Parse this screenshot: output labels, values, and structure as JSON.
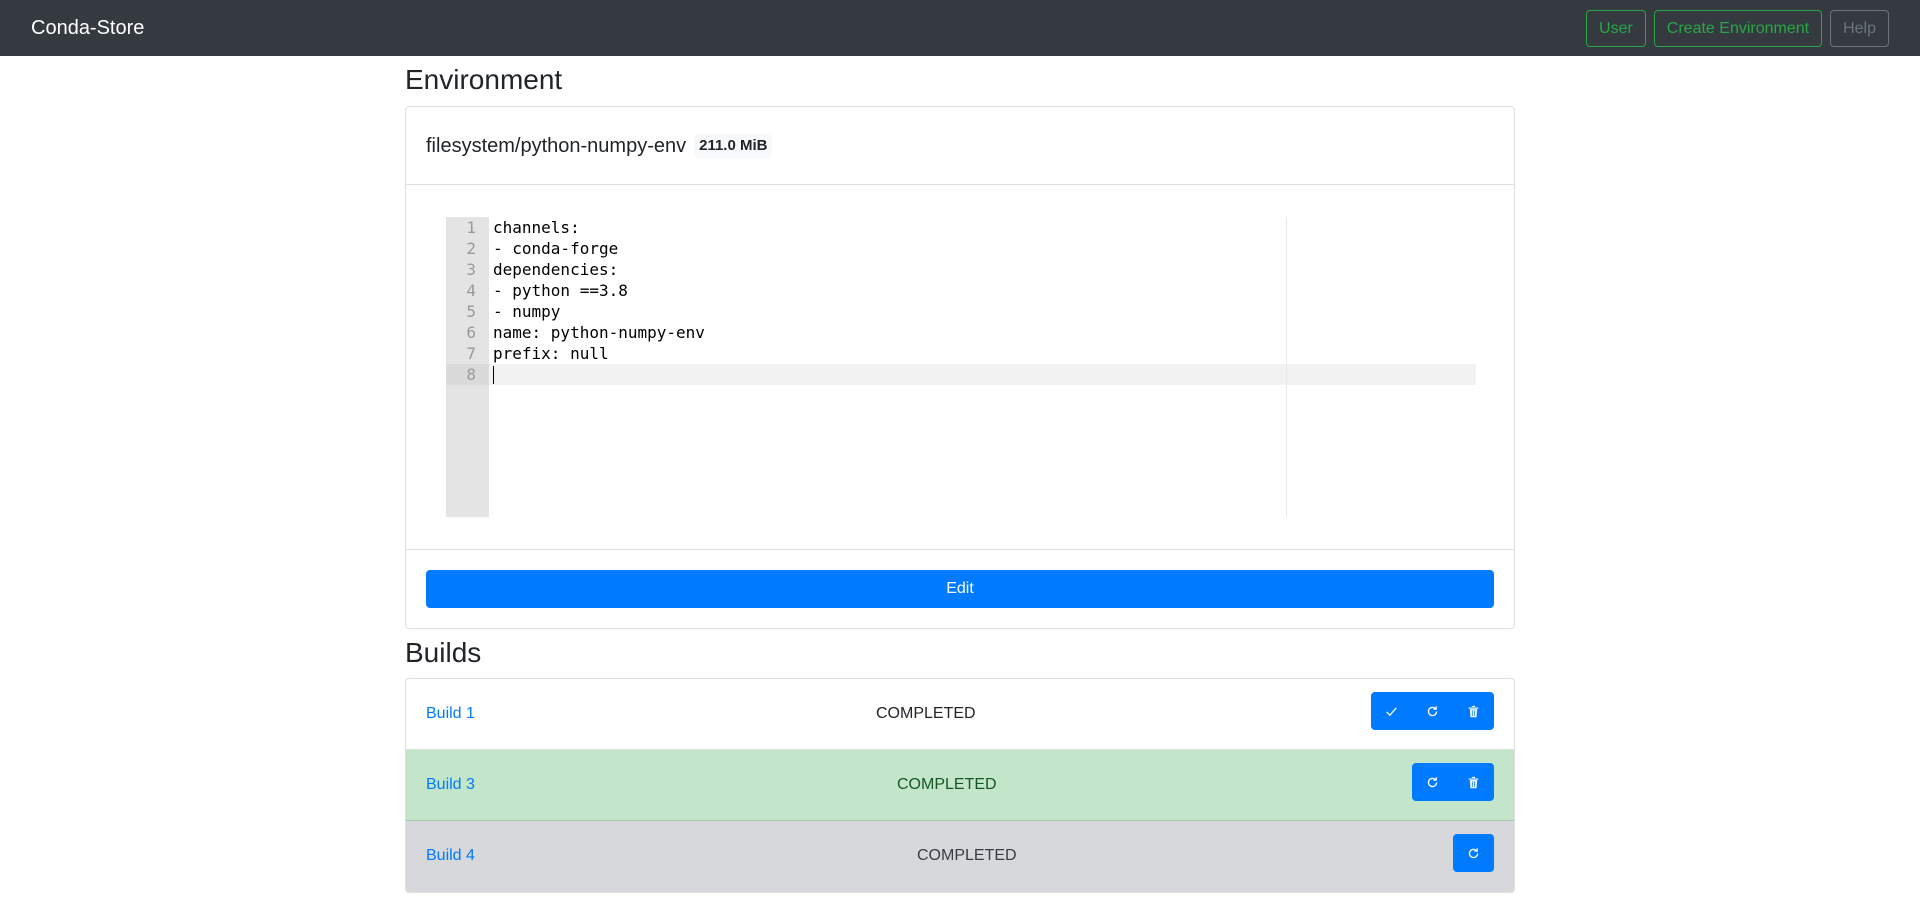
{
  "navbar": {
    "brand": "Conda-Store",
    "buttons": {
      "user": "User",
      "create": "Create Environment",
      "help": "Help"
    }
  },
  "environment": {
    "heading": "Environment",
    "name": "filesystem/python-numpy-env",
    "size": "211.0 MiB",
    "editor": {
      "line_numbers": [
        "1",
        "2",
        "3",
        "4",
        "5",
        "6",
        "7",
        "8"
      ],
      "lines": [
        "channels:",
        "- conda-forge",
        "dependencies:",
        "- python ==3.8",
        "- numpy",
        "name: python-numpy-env",
        "prefix: null",
        ""
      ]
    },
    "edit_label": "Edit"
  },
  "builds": {
    "heading": "Builds",
    "rows": [
      {
        "label": "Build 1",
        "status": "COMPLETED",
        "actions": [
          "check-icon",
          "refresh-icon",
          "trash-icon"
        ]
      },
      {
        "label": "Build 3",
        "status": "COMPLETED",
        "actions": [
          "refresh-icon",
          "trash-icon"
        ]
      },
      {
        "label": "Build 4",
        "status": "COMPLETED",
        "actions": [
          "refresh-icon"
        ]
      }
    ]
  },
  "colors": {
    "navbar": "#343a40",
    "primary": "#007bff",
    "success_outline": "#28a745",
    "current_row": "#c3e6cb",
    "inactive_row": "#d6d8db"
  }
}
